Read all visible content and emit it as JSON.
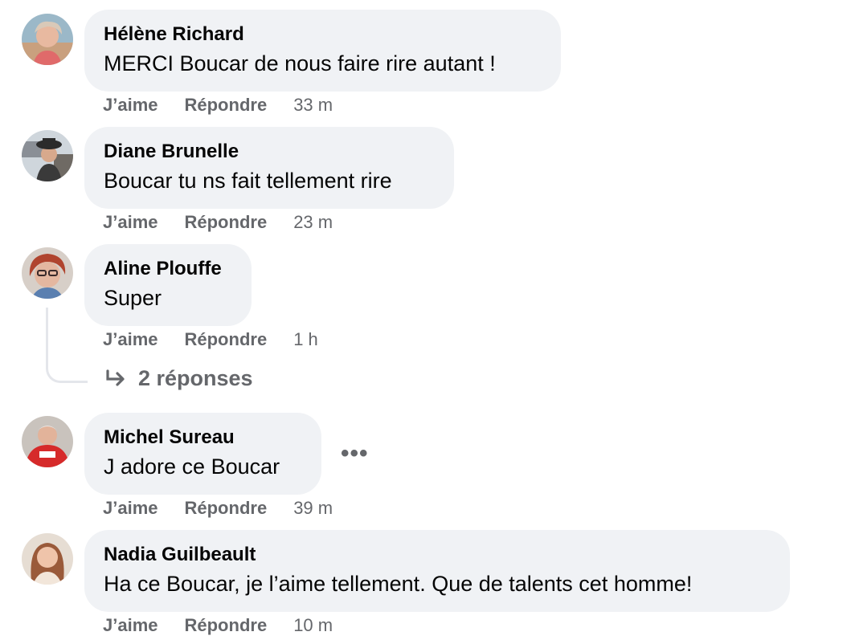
{
  "comments": [
    {
      "author": "Hélène Richard",
      "text": "MERCI Boucar de nous faire rire autant !",
      "like": "J’aime",
      "reply": "Répondre",
      "time": "33 m"
    },
    {
      "author": "Diane Brunelle",
      "text": "Boucar tu ns fait tellement rire",
      "like": "J’aime",
      "reply": "Répondre",
      "time": "23 m"
    },
    {
      "author": "Aline Plouffe",
      "text": "Super",
      "like": "J’aime",
      "reply": "Répondre",
      "time": "1 h",
      "replies_label": "2 réponses"
    },
    {
      "author": "Michel Sureau",
      "text": "J adore ce Boucar",
      "like": "J’aime",
      "reply": "Répondre",
      "time": "39 m",
      "more": "•••"
    },
    {
      "author": "Nadia Guilbeault",
      "text": "Ha ce Boucar, je l’aime tellement. Que de talents cet homme!",
      "like": "J’aime",
      "reply": "Répondre",
      "time": "10 m"
    }
  ],
  "colors": {
    "bubble": "#f0f2f5",
    "muted": "#65676b",
    "text": "#050505"
  },
  "icons": {
    "reply_arrow": "reply-arrow-icon",
    "more": "more-options-icon"
  }
}
